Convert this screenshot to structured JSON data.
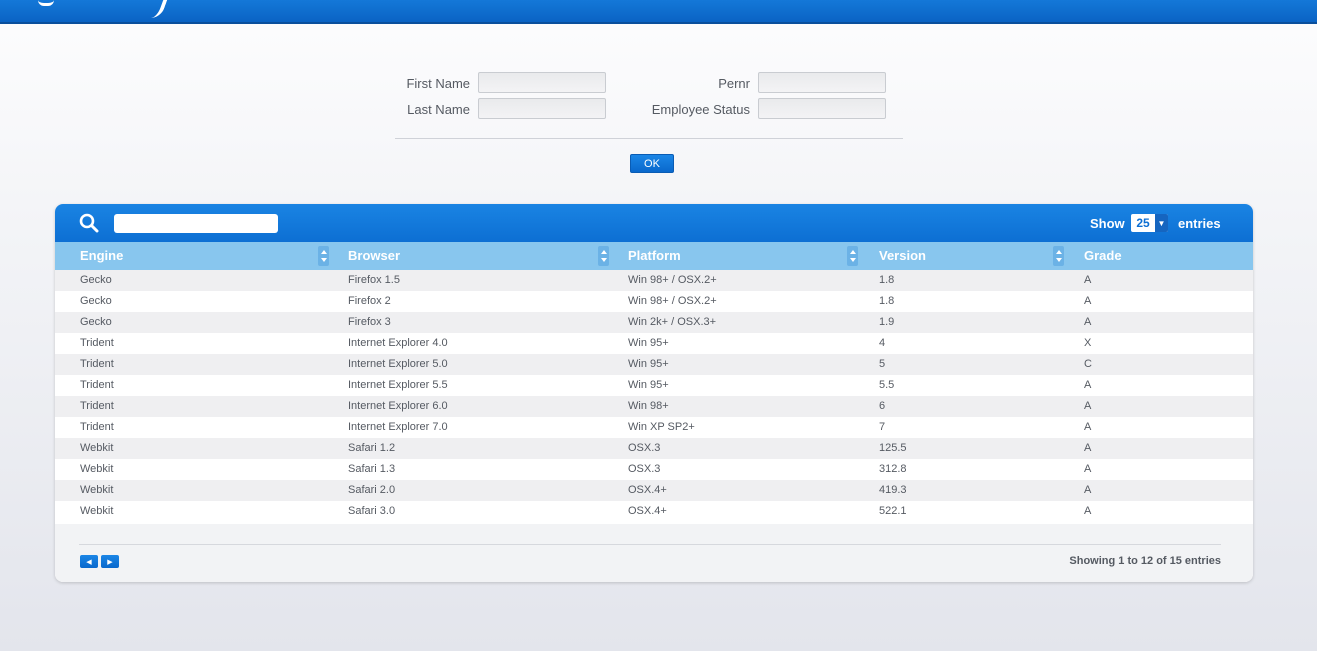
{
  "form": {
    "first_name_label": "First Name",
    "last_name_label": "Last Name",
    "pernr_label": "Pernr",
    "employee_status_label": "Employee Status",
    "first_name_value": "",
    "last_name_value": "",
    "pernr_value": "",
    "employee_status_value": "",
    "ok_label": "OK"
  },
  "table": {
    "search_value": "",
    "show_label": "Show",
    "entries_label": "entries",
    "page_length": "25",
    "columns": [
      "Engine",
      "Browser",
      "Platform",
      "Version",
      "Grade"
    ],
    "rows": [
      [
        "Gecko",
        "Firefox 1.5",
        "Win 98+ / OSX.2+",
        "1.8",
        "A"
      ],
      [
        "Gecko",
        "Firefox 2",
        "Win 98+ / OSX.2+",
        "1.8",
        "A"
      ],
      [
        "Gecko",
        "Firefox 3",
        "Win 2k+ / OSX.3+",
        "1.9",
        "A"
      ],
      [
        "Trident",
        "Internet Explorer 4.0",
        "Win 95+",
        "4",
        "X"
      ],
      [
        "Trident",
        "Internet Explorer 5.0",
        "Win 95+",
        "5",
        "C"
      ],
      [
        "Trident",
        "Internet Explorer 5.5",
        "Win 95+",
        "5.5",
        "A"
      ],
      [
        "Trident",
        "Internet Explorer 6.0",
        "Win 98+",
        "6",
        "A"
      ],
      [
        "Trident",
        "Internet Explorer 7.0",
        "Win XP SP2+",
        "7",
        "A"
      ],
      [
        "Webkit",
        "Safari 1.2",
        "OSX.3",
        "125.5",
        "A"
      ],
      [
        "Webkit",
        "Safari 1.3",
        "OSX.3",
        "312.8",
        "A"
      ],
      [
        "Webkit",
        "Safari 2.0",
        "OSX.4+",
        "419.3",
        "A"
      ],
      [
        "Webkit",
        "Safari 3.0",
        "OSX.4+",
        "522.1",
        "A"
      ]
    ],
    "info": "Showing 1 to 12 of 15 entries",
    "prev_icon": "previous-page-icon",
    "next_icon": "next-page-icon"
  },
  "colors": {
    "header_blue": "#0d6fd3",
    "column_header": "#88c6ee",
    "row_alt": "#efeff1"
  }
}
